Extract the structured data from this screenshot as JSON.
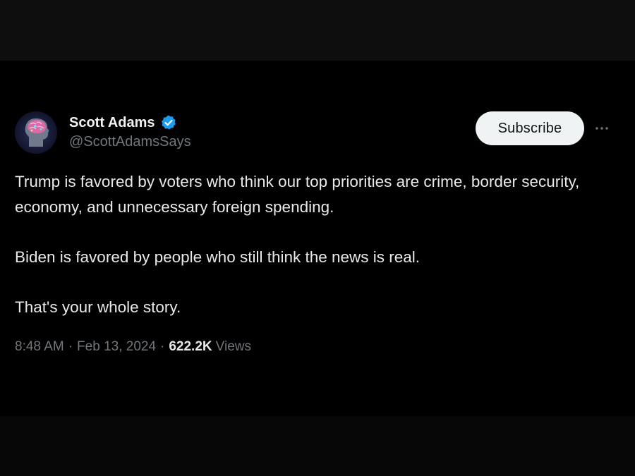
{
  "author": {
    "display_name": "Scott Adams",
    "handle": "@ScottAdamsSays",
    "verified": true,
    "avatar_icon": "brain-head-avatar-icon"
  },
  "actions": {
    "subscribe_label": "Subscribe",
    "more_icon": "more-options-icon"
  },
  "tweet": {
    "paragraphs": [
      "Trump is favored by voters who think our top priorities are crime, border security, economy, and unnecessary foreign spending.",
      "Biden is favored by people who still think the news is real.",
      "That's your whole story."
    ],
    "time": "8:48 AM",
    "separator": "·",
    "date": "Feb 13, 2024",
    "views_count": "622.2K",
    "views_label": "Views"
  },
  "colors": {
    "background": "#000000",
    "text_primary": "#e7e9ea",
    "text_secondary": "#71767b",
    "verified_badge": "#1d9bf0",
    "subscribe_bg": "#eff3f4"
  }
}
